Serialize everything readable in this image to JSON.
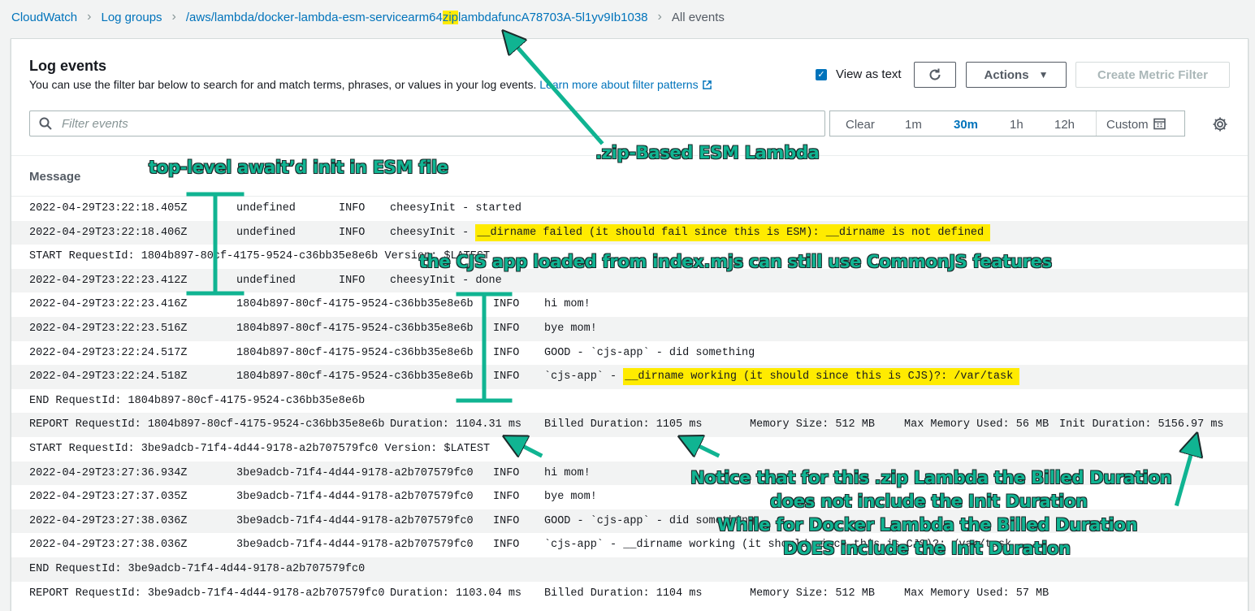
{
  "breadcrumb": {
    "cloudwatch": "CloudWatch",
    "log_groups": "Log groups",
    "group_before": "/aws/lambda/docker-lambda-esm-servicearm64",
    "group_highlight": "zip",
    "group_after": "lambdafuncA78703A-5l1yv9Ib1038",
    "current": "All events"
  },
  "panel": {
    "title": "Log events",
    "description": "You can use the filter bar below to search for and match terms, phrases, or values in your log events. ",
    "learn_more": "Learn more about filter patterns",
    "view_as_text": "View as text",
    "actions": "Actions",
    "create_metric_filter": "Create Metric Filter",
    "filter_placeholder": "Filter events",
    "time_ranges": [
      "Clear",
      "1m",
      "30m",
      "1h",
      "12h"
    ],
    "active_range": "30m",
    "custom": "Custom",
    "message_header": "Message"
  },
  "logs": [
    {
      "ts": "2022-04-29T23:22:18.405Z",
      "id": "undefined",
      "level": "INFO",
      "msg": "cheesyInit - started"
    },
    {
      "ts": "2022-04-29T23:22:18.406Z",
      "id": "undefined",
      "level": "INFO",
      "msg_pre": "cheesyInit - ",
      "msg_hl": "__dirname failed (it should fail since this is ESM): __dirname is not defined"
    },
    {
      "line": "START RequestId: 1804b897-80cf-4175-9524-c36bb35e8e6b Version: $LATEST"
    },
    {
      "ts": "2022-04-29T23:22:23.412Z",
      "id": "undefined",
      "level": "INFO",
      "msg": "cheesyInit - done"
    },
    {
      "ts": "2022-04-29T23:22:23.416Z",
      "id": "1804b897-80cf-4175-9524-c36bb35e8e6b",
      "level": "INFO",
      "msg": "hi mom!"
    },
    {
      "ts": "2022-04-29T23:22:23.516Z",
      "id": "1804b897-80cf-4175-9524-c36bb35e8e6b",
      "level": "INFO",
      "msg": "bye mom!"
    },
    {
      "ts": "2022-04-29T23:22:24.517Z",
      "id": "1804b897-80cf-4175-9524-c36bb35e8e6b",
      "level": "INFO",
      "msg": "GOOD - `cjs-app` - did something"
    },
    {
      "ts": "2022-04-29T23:22:24.518Z",
      "id": "1804b897-80cf-4175-9524-c36bb35e8e6b",
      "level": "INFO",
      "msg_pre": "`cjs-app` - ",
      "msg_hl": "__dirname working (it should since this is CJS)?: /var/task"
    },
    {
      "line": "END RequestId: 1804b897-80cf-4175-9524-c36bb35e8e6b"
    },
    {
      "report": [
        "REPORT RequestId: 1804b897-80cf-4175-9524-c36bb35e8e6b",
        "Duration: 1104.31 ms",
        "Billed Duration: 1105 ms",
        "Memory Size: 512 MB",
        "Max Memory Used: 56 MB",
        "Init Duration: 5156.97 ms"
      ]
    },
    {
      "line": "START RequestId: 3be9adcb-71f4-4d44-9178-a2b707579fc0 Version: $LATEST"
    },
    {
      "ts": "2022-04-29T23:27:36.934Z",
      "id": "3be9adcb-71f4-4d44-9178-a2b707579fc0",
      "level": "INFO",
      "msg": "hi mom!"
    },
    {
      "ts": "2022-04-29T23:27:37.035Z",
      "id": "3be9adcb-71f4-4d44-9178-a2b707579fc0",
      "level": "INFO",
      "msg": "bye mom!"
    },
    {
      "ts": "2022-04-29T23:27:38.036Z",
      "id": "3be9adcb-71f4-4d44-9178-a2b707579fc0",
      "level": "INFO",
      "msg": "GOOD - `cjs-app` - did something"
    },
    {
      "ts": "2022-04-29T23:27:38.036Z",
      "id": "3be9adcb-71f4-4d44-9178-a2b707579fc0",
      "level": "INFO",
      "msg": "`cjs-app` - __dirname working (it should since this is CJS)?: /var/task"
    },
    {
      "line": "END RequestId: 3be9adcb-71f4-4d44-9178-a2b707579fc0"
    },
    {
      "report": [
        "REPORT RequestId: 3be9adcb-71f4-4d44-9178-a2b707579fc0",
        "Duration: 1103.04 ms",
        "Billed Duration: 1104 ms",
        "Memory Size: 512 MB",
        "Max Memory Used: 57 MB",
        ""
      ]
    }
  ],
  "annotations": {
    "esm_init": "top-level await’d init in ESM file",
    "zip_based": ".zip-Based ESM Lambda",
    "cjs_app": "the CJS app loaded from index.mjs can still use CommonJS features",
    "note_1": "Notice that for this .zip Lambda the Billed Duration",
    "note_2": "does not include the Init Duration",
    "note_3": "While for Docker Lambda the Billed Duration",
    "note_4": "DOES include the Init Duration"
  },
  "colors": {
    "accent": "#0073bb",
    "highlight": "#ffeb00",
    "annotation": "#10b492"
  }
}
